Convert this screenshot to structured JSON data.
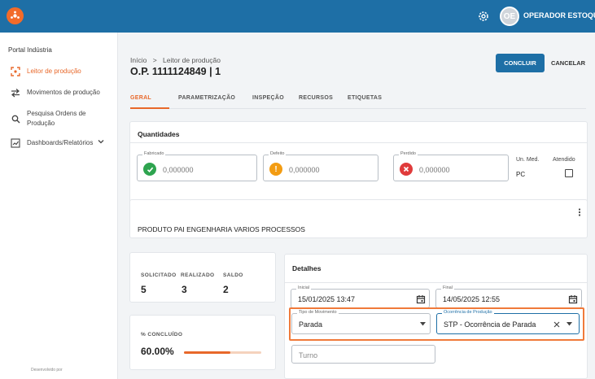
{
  "header": {
    "user_initials": "OE",
    "user_name": "OPERADOR ESTOQUE",
    "bar_color": "#1e6fa6",
    "logo_color": "#f26b2a"
  },
  "sidebar": {
    "title": "Portal Indústria",
    "items": [
      {
        "label": "Leitor de produção",
        "icon": "scanner-icon",
        "active": true
      },
      {
        "label": "Movimentos de produção",
        "icon": "swap-arrows-icon"
      },
      {
        "label_line1": "Pesquisa Ordens de",
        "label_line2": "Produção",
        "icon": "search-icon"
      },
      {
        "label": "Dashboards/Relatórios",
        "icon": "dashboard-icon"
      }
    ],
    "footer": "Desenvolvido por"
  },
  "page": {
    "breadcrumb_home": "Início",
    "breadcrumb_sep": ">",
    "breadcrumb_current": "Leitor de produção",
    "title": "O.P. 1111124849 | 1",
    "concluir_label": "CONCLUIR",
    "cancelar_label": "CANCELAR",
    "accent": "#e8682a"
  },
  "tabs": [
    "GERAL",
    "PARAMETRIZAÇÃO",
    "INSPEÇÃO",
    "RECURSOS",
    "ETIQUETAS"
  ],
  "quantidades": {
    "title": "Quantidades",
    "fabricado": {
      "label": "Fabricado",
      "value": "0,000000",
      "status_color": "#2ea44f"
    },
    "defeito": {
      "label": "Defeito",
      "value": "0,000000",
      "status_color": "#f39c12"
    },
    "perdido": {
      "label": "Perdido",
      "value": "0,000000",
      "status_color": "#e03b3b"
    },
    "un_med_label": "Un. Med.",
    "un_med_value": "PC",
    "atendido_label": "Atendido"
  },
  "produto": {
    "description": "PRODUTO PAI ENGENHARIA VARIOS PROCESSOS"
  },
  "resumo": {
    "solicitado_label": "SOLICITADO",
    "solicitado_value": "5",
    "realizado_label": "REALIZADO",
    "realizado_value": "3",
    "saldo_label": "SALDO",
    "saldo_value": "2",
    "concluido_label": "% CONCLUÍDO",
    "concluido_value": "60.00%",
    "concluido_fraction": 0.6
  },
  "detalhes": {
    "title": "Detalhes",
    "inicial_label": "Inicial",
    "inicial_value": "15/01/2025 13:47",
    "final_label": "Final",
    "final_value": "14/05/2025 12:55",
    "tipo_label": "Tipo de Movimento",
    "tipo_value": "Parada",
    "ocorrencia_label": "Ocorrência de Produção",
    "ocorrencia_value": "STP - Ocorrência de Parada",
    "turno_placeholder": "Turno"
  }
}
